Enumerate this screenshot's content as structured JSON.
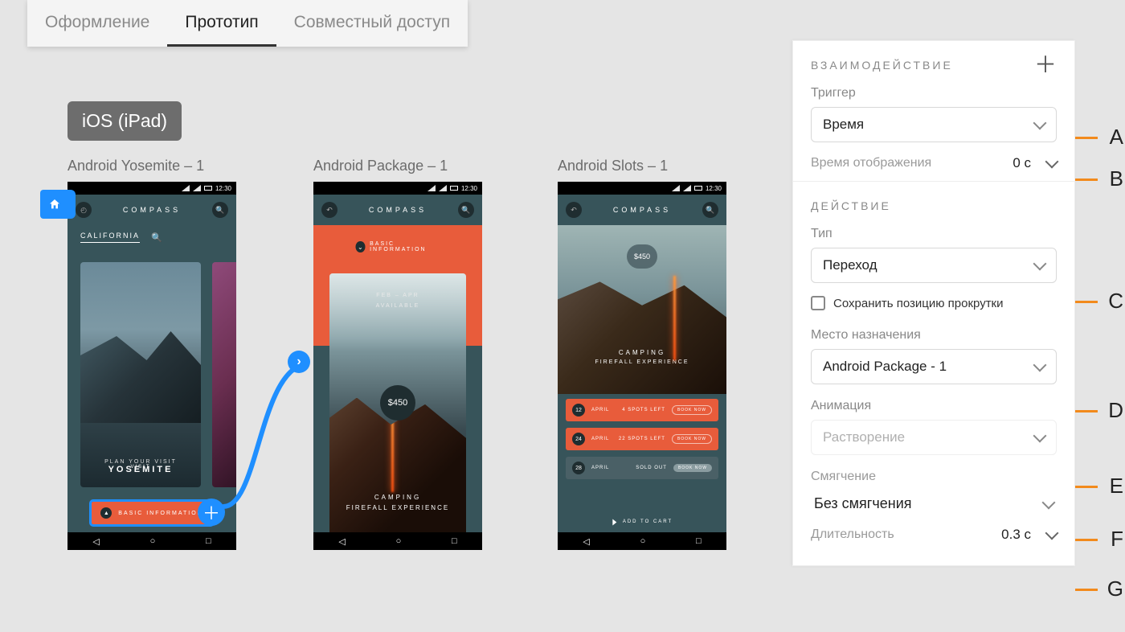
{
  "tabs": {
    "design": "Оформление",
    "prototype": "Прототип",
    "share": "Совместный доступ"
  },
  "device_chip": "iOS (iPad)",
  "artboards": {
    "a1": "Android Yosemite – 1",
    "a2": "Android Package – 1",
    "a3": "Android Slots – 1"
  },
  "status_time": "12:30",
  "app_brand": "COMPASS",
  "phone1": {
    "tab_selected": "CALIFORNIA",
    "card_sub": "PLAN YOUR VISIT",
    "card_title": "YOSEMITE",
    "visit": "VISIT",
    "button": "BASIC INFORMATION"
  },
  "phone2": {
    "chip": "BASIC INFORMATION",
    "avail1": "FEB – APR",
    "avail2": "AVAILABLE",
    "price": "$450",
    "camp": "CAMPING",
    "exp": "FIREFALL EXPERIENCE"
  },
  "phone3": {
    "price": "$450",
    "camp": "CAMPING",
    "exp": "FIREFALL EXPERIENCE",
    "slots": [
      {
        "day": "12",
        "month": "APRIL",
        "spots": "4 SPOTS LEFT",
        "cta": "BOOK NOW",
        "cls": "orange"
      },
      {
        "day": "24",
        "month": "APRIL",
        "spots": "22 SPOTS LEFT",
        "cta": "BOOK NOW",
        "cls": "orange"
      },
      {
        "day": "28",
        "month": "APRIL",
        "spots": "SOLD OUT",
        "cta": "BOOK NOW",
        "cls": "gray"
      }
    ],
    "cart": "ADD TO CART"
  },
  "panel": {
    "interaction_header": "ВЗАИМОДЕЙСТВИЕ",
    "trigger_label": "Триггер",
    "trigger_value": "Время",
    "display_time_label": "Время отображения",
    "display_time_value": "0 с",
    "action_header": "ДЕЙСТВИЕ",
    "type_label": "Тип",
    "type_value": "Переход",
    "preserve_scroll": "Сохранить позицию прокрутки",
    "destination_label": "Место назначения",
    "destination_value": "Android Package - 1",
    "animation_label": "Анимация",
    "animation_value": "Растворение",
    "easing_label": "Смягчение",
    "easing_value": "Без смягчения",
    "duration_label": "Длительность",
    "duration_value": "0.3 с"
  },
  "callouts": {
    "A": "A",
    "B": "B",
    "C": "C",
    "D": "D",
    "E": "E",
    "F": "F",
    "G": "G"
  }
}
